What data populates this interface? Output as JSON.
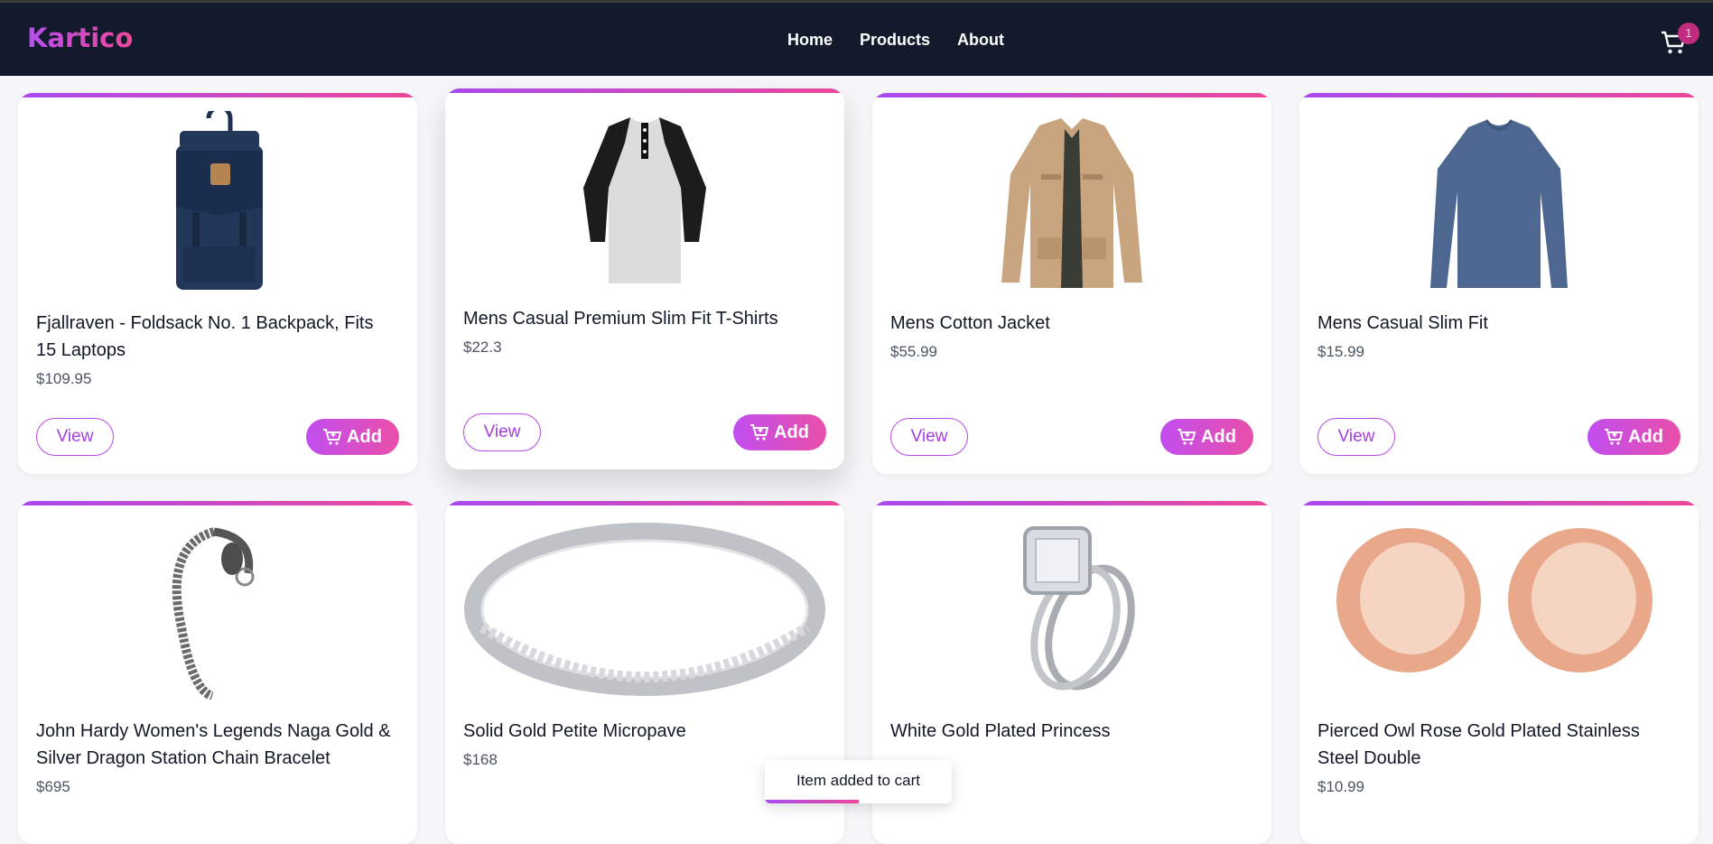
{
  "brand": "Kartico",
  "nav": [
    "Home",
    "Products",
    "About"
  ],
  "cart": {
    "icon": "cart-icon",
    "count": "1"
  },
  "buttons": {
    "view": "View",
    "add": "Add"
  },
  "products": [
    {
      "title": "Fjallraven - Foldsack No. 1 Backpack, Fits 15 Laptops",
      "price": "$109.95",
      "image": "backpack"
    },
    {
      "title": "Mens Casual Premium Slim Fit T-Shirts",
      "price": "$22.3",
      "image": "tshirt"
    },
    {
      "title": "Mens Cotton Jacket",
      "price": "$55.99",
      "image": "jacket"
    },
    {
      "title": "Mens Casual Slim Fit",
      "price": "$15.99",
      "image": "longsleeve"
    },
    {
      "title": "John Hardy Women's Legends Naga Gold & Silver Dragon Station Chain Bracelet",
      "price": "$695",
      "image": "bracelet"
    },
    {
      "title": "Solid Gold Petite Micropave",
      "price": "$168",
      "image": "ring"
    },
    {
      "title": "White Gold Plated Princess",
      "price": "",
      "image": "engagement-ring"
    },
    {
      "title": "Pierced Owl Rose Gold Plated Stainless Steel Double",
      "price": "$10.99",
      "image": "rose-gold-tunnels"
    }
  ],
  "toast": {
    "message": "Item added to cart",
    "progress": 0.5
  },
  "colors": {
    "accent": "#b84ef0",
    "accent2": "#ec4899",
    "navbar": "#131a2b"
  }
}
